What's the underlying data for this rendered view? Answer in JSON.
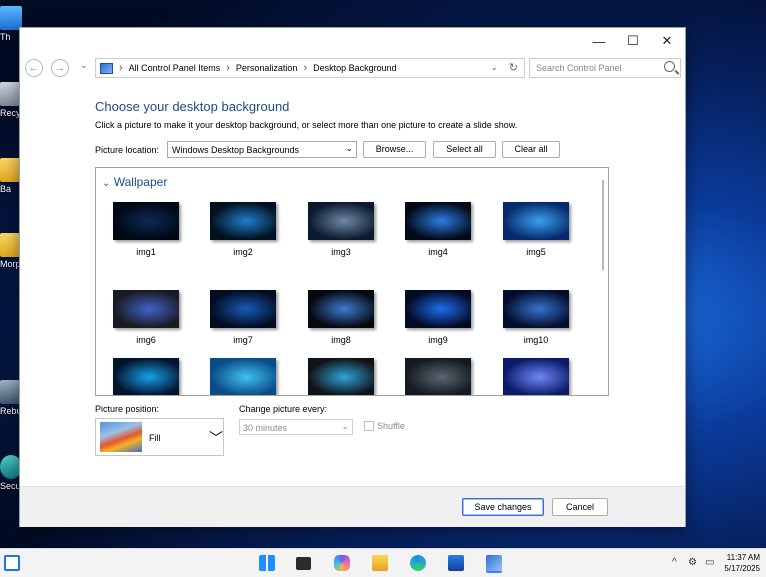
{
  "desktop": {
    "icons": [
      {
        "label": "Th"
      },
      {
        "label": "Recy"
      },
      {
        "label": "Ba"
      },
      {
        "label": "Morp"
      },
      {
        "label": "Rebu"
      },
      {
        "label": "Secu"
      }
    ]
  },
  "window": {
    "controls": {
      "minimize": "—",
      "maximize": "☐",
      "close": "✕"
    },
    "nav": {
      "back": "←",
      "forward": "→",
      "dropdown": "⌄"
    },
    "breadcrumb": [
      "All Control Panel Items",
      "Personalization",
      "Desktop Background"
    ],
    "breadcrumb_sep": "›",
    "search": {
      "placeholder": "Search Control Panel"
    }
  },
  "page": {
    "title": "Choose your desktop background",
    "description": "Click a picture to make it your desktop background, or select more than one picture to create a slide show.",
    "picture_location_label": "Picture location:",
    "picture_location_value": "Windows Desktop Backgrounds",
    "browse": "Browse...",
    "select_all": "Select all",
    "clear_all": "Clear all",
    "group": "Wallpaper",
    "images": [
      {
        "label": "img1",
        "colors": [
          "#000814",
          "#0d2a55"
        ]
      },
      {
        "label": "img2",
        "colors": [
          "#02101f",
          "#1f7fcc"
        ]
      },
      {
        "label": "img3",
        "colors": [
          "#0b1a2e",
          "#6f8aa8"
        ]
      },
      {
        "label": "img4",
        "colors": [
          "#020a18",
          "#2b7de0"
        ]
      },
      {
        "label": "img5",
        "colors": [
          "#062a6b",
          "#3aa0f0"
        ]
      },
      {
        "label": "img6",
        "colors": [
          "#1a1a22",
          "#3f63c9"
        ]
      },
      {
        "label": "img7",
        "colors": [
          "#030c22",
          "#175ab6"
        ]
      },
      {
        "label": "img8",
        "colors": [
          "#05080f",
          "#3d7bd0"
        ]
      },
      {
        "label": "img9",
        "colors": [
          "#030a24",
          "#1e6bef"
        ]
      },
      {
        "label": "img10",
        "colors": [
          "#040e2c",
          "#3672cf"
        ]
      },
      {
        "label": "",
        "colors": [
          "#02142e",
          "#16a0e8"
        ]
      },
      {
        "label": "",
        "colors": [
          "#0a4b88",
          "#3fc2f0"
        ]
      },
      {
        "label": "",
        "colors": [
          "#101318",
          "#2fa4d8"
        ]
      },
      {
        "label": "",
        "colors": [
          "#141a22",
          "#5b6570"
        ]
      },
      {
        "label": "",
        "colors": [
          "#0b1a6a",
          "#6f8af5"
        ]
      }
    ],
    "picture_position_label": "Picture position:",
    "picture_position_value": "Fill",
    "change_picture_label": "Change picture every:",
    "change_picture_value": "30 minutes",
    "shuffle": "Shuffle",
    "save": "Save changes",
    "cancel": "Cancel"
  },
  "taskbar": {
    "time": "11:37 AM",
    "date": "5/17/2025",
    "tray_chevron": "^"
  }
}
